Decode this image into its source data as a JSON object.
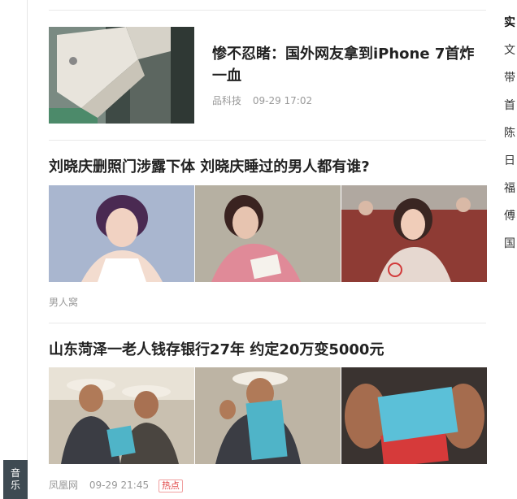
{
  "music_tab": {
    "label": "音乐"
  },
  "articles": [
    {
      "title": "惨不忍睹：国外网友拿到iPhone 7首炸一血",
      "source": "品科技",
      "time": "09-29 17:02"
    },
    {
      "title": "刘晓庆删照门涉露下体 刘晓庆睡过的男人都有谁?",
      "source": "男人窝"
    },
    {
      "title": "山东菏泽一老人钱存银行27年 约定20万变5000元",
      "source": "凤凰网",
      "time": "09-29 21:45",
      "badge": "热点"
    }
  ],
  "side_list": [
    "实",
    "文",
    "带",
    "首",
    "陈",
    "日",
    "福",
    "傅",
    "国"
  ],
  "colors": {
    "title": "#222222",
    "meta": "#999999",
    "badge": "#e04545",
    "music_tab_bg": "#3e4a52"
  }
}
